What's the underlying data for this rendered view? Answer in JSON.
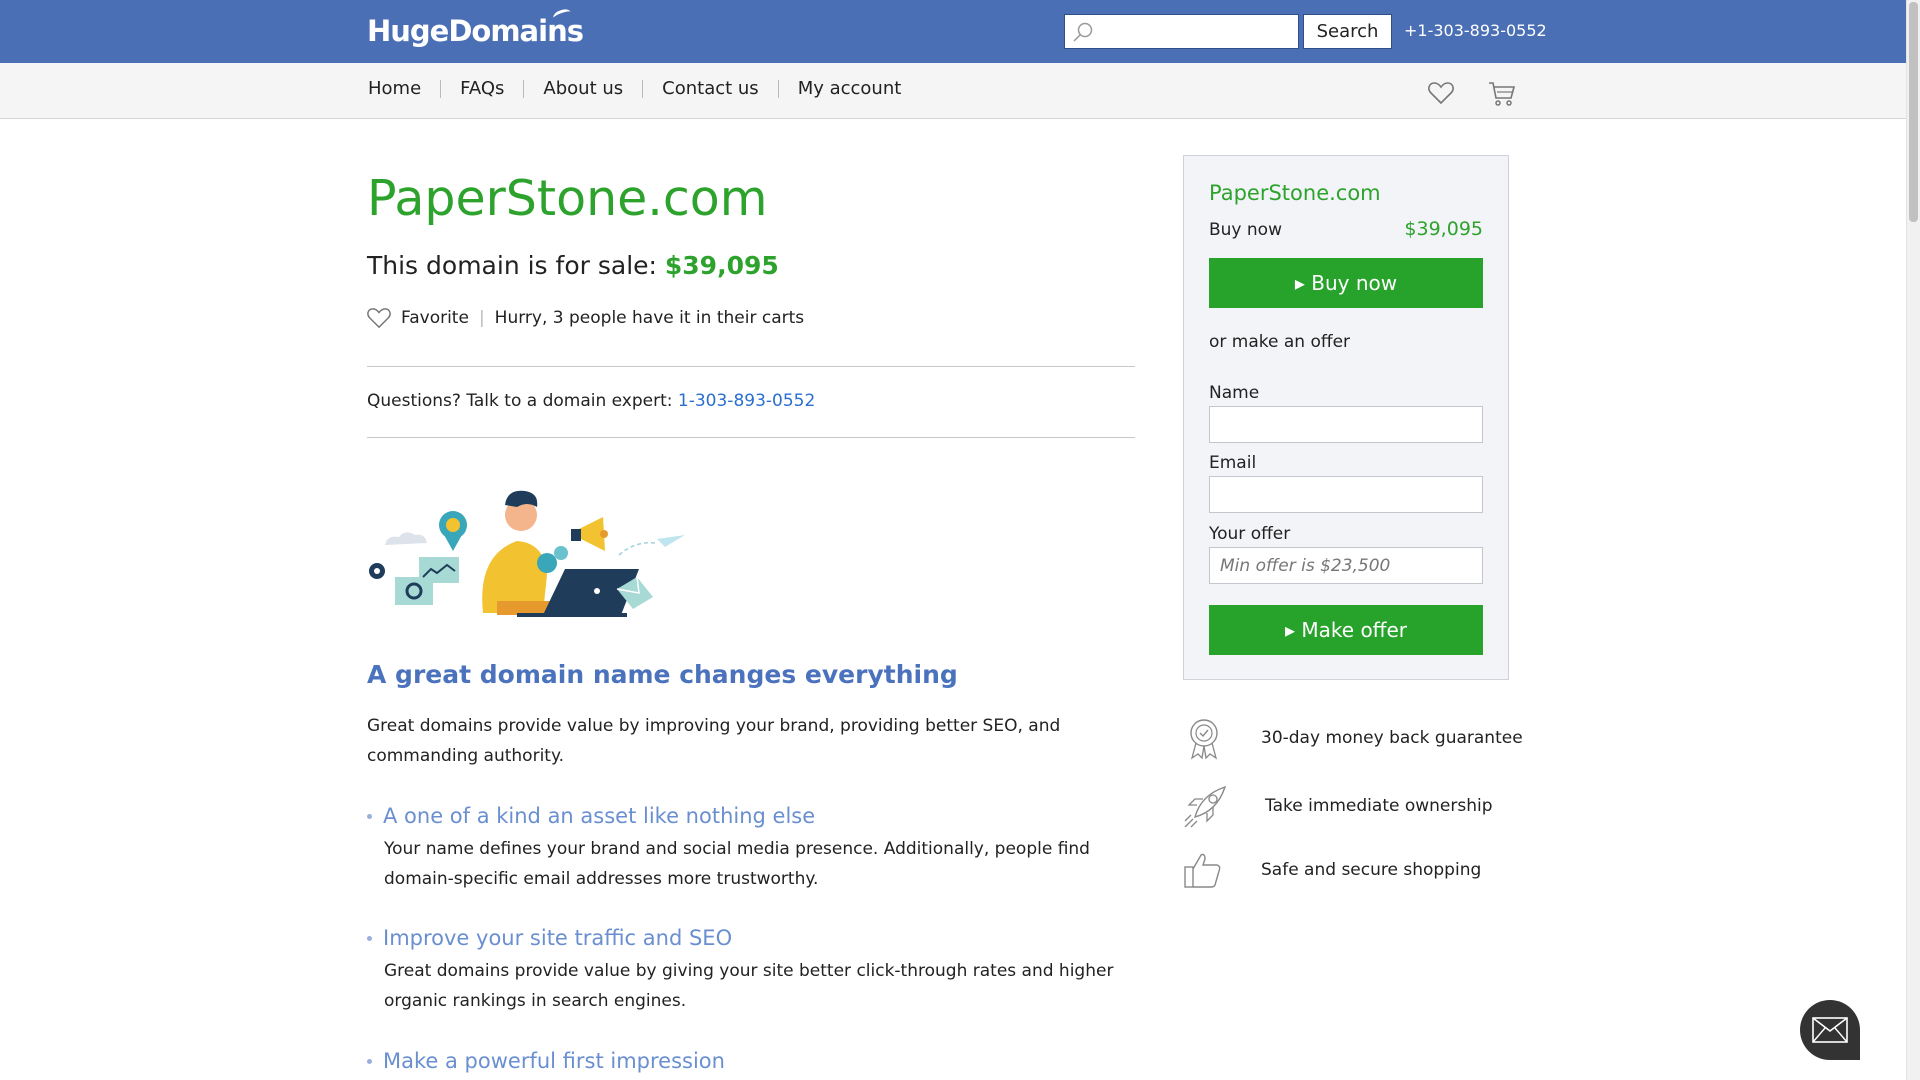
{
  "header": {
    "logo": "HugeDomains",
    "search_placeholder": "",
    "search_button": "Search",
    "phone": "+1-303-893-0552"
  },
  "nav": {
    "items": [
      {
        "label": "Home"
      },
      {
        "label": "FAQs"
      },
      {
        "label": "About us"
      },
      {
        "label": "Contact us"
      },
      {
        "label": "My account"
      }
    ],
    "icons": [
      "heart-icon",
      "cart-icon"
    ]
  },
  "main": {
    "domain": "PaperStone.com",
    "for_sale_text": "This domain is for sale: ",
    "price": "$39,095",
    "favorite_label": "Favorite",
    "carts_text": "Hurry, 3 people have it in their carts",
    "questions_text": "Questions? Talk to a domain expert: ",
    "questions_phone": "1-303-893-0552",
    "section_title": "A great domain name changes everything",
    "intro": "Great domains provide value by improving your brand, providing better SEO, and commanding authority.",
    "benefits": [
      {
        "title": "A one of a kind an asset like nothing else",
        "body": "Your name defines your brand and social media presence. Additionally, people find domain-specific email addresses more trustworthy."
      },
      {
        "title": "Improve your site traffic and SEO",
        "body": "Great domains provide value by giving your site better click-through rates and higher organic rankings in search engines."
      },
      {
        "title": "Make a powerful first impression",
        "body": ""
      }
    ]
  },
  "card": {
    "domain": "PaperStone.com",
    "buy_now_label": "Buy now",
    "price": "$39,095",
    "buy_button": "▸ Buy now",
    "offer_text": "or make an offer",
    "name_label": "Name",
    "email_label": "Email",
    "offer_label": "Your offer",
    "offer_placeholder": "Min offer is $23,500",
    "offer_button": "▸ Make offer"
  },
  "features": [
    {
      "icon": "ribbon-award-icon",
      "label": "30-day money back guarantee"
    },
    {
      "icon": "rocket-icon",
      "label": "Take immediate ownership"
    },
    {
      "icon": "thumbs-up-icon",
      "label": "Safe and secure shopping"
    }
  ],
  "colors": {
    "header_blue": "#4b6fb5",
    "green": "#27a22b",
    "link_blue": "#2a6fce",
    "section_blue": "#4b72bd"
  }
}
